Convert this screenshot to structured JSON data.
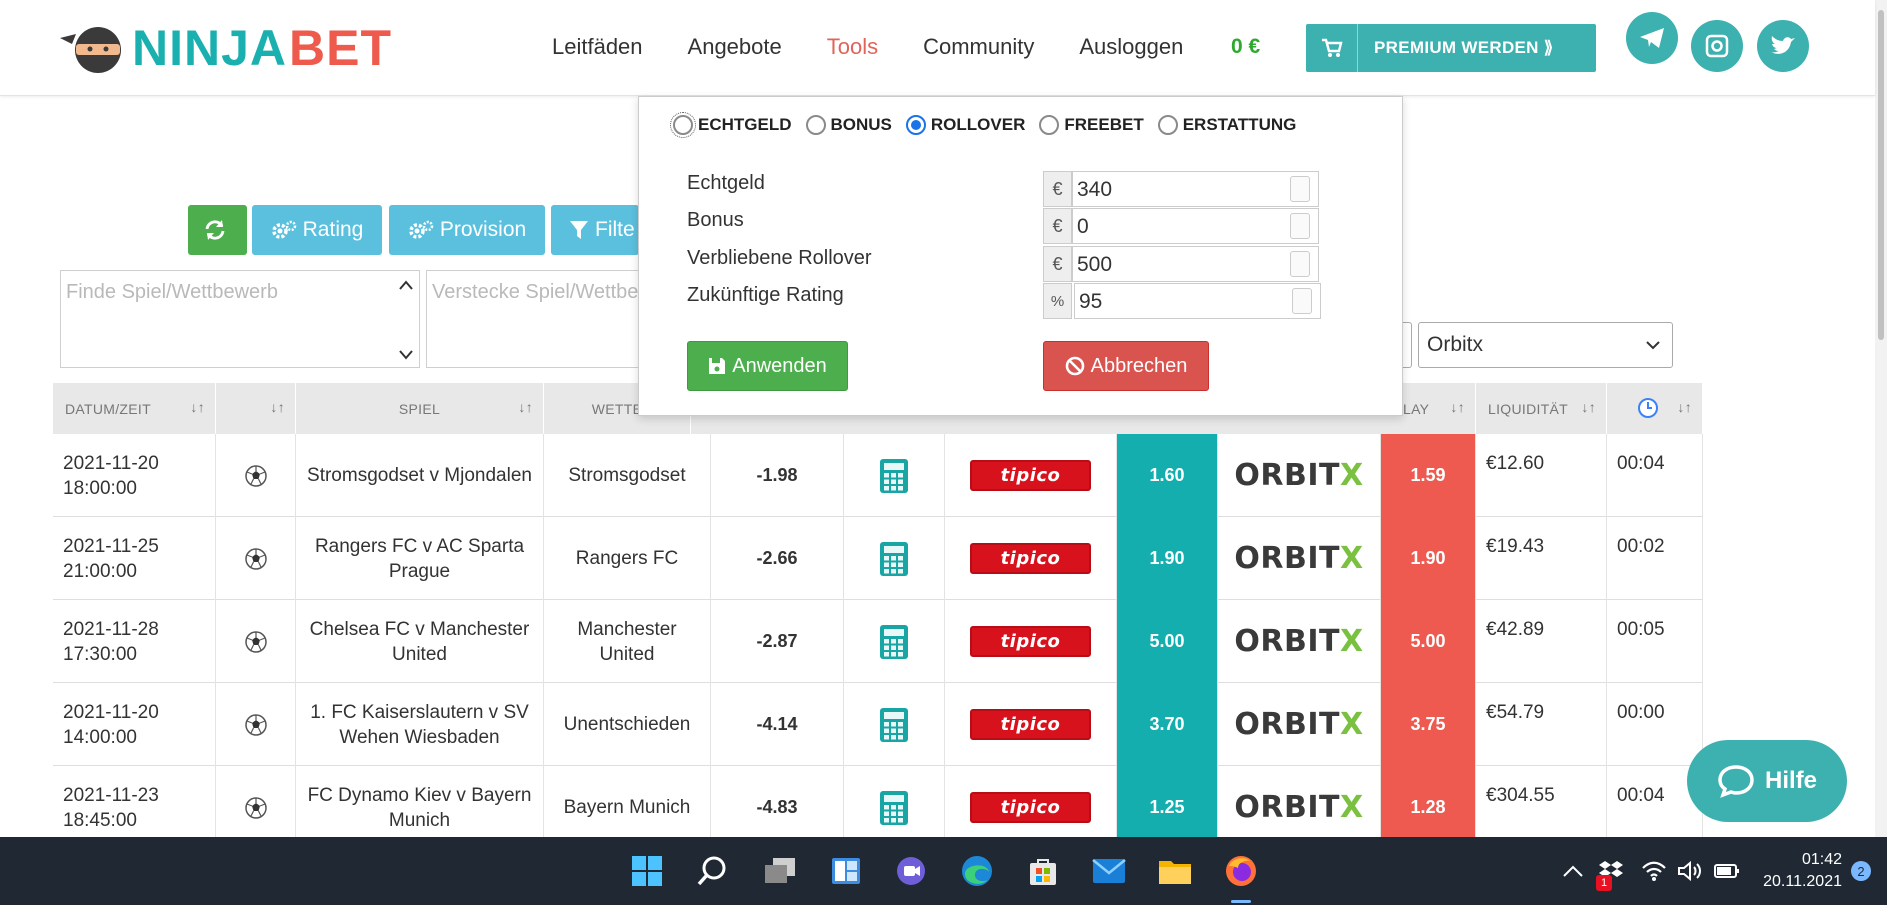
{
  "header": {
    "logo": {
      "part1": "NINJA",
      "part2": "BET"
    },
    "nav": [
      "Leitfäden",
      "Angebote",
      "Tools",
      "Community",
      "Ausloggen"
    ],
    "active_nav": "Tools",
    "balance": "0 €",
    "premium_label": "PREMIUM WERDEN ⟫",
    "social_icons": [
      "telegram-icon",
      "instagram-icon",
      "twitter-icon"
    ]
  },
  "toolbar": {
    "refresh_icon": "refresh-icon",
    "rating_label": "Rating",
    "provision_label": "Provision",
    "filter_label": "Filte",
    "search_placeholder": "Finde Spiel/Wettbewerb",
    "hide_placeholder": "Versteckе Spiel/Wettbe",
    "exchange_select": "Orbitx"
  },
  "popup": {
    "radios": [
      {
        "label": "ECHTGELD",
        "checked": false
      },
      {
        "label": "BONUS",
        "checked": false
      },
      {
        "label": "ROLLOVER",
        "checked": true
      },
      {
        "label": "FREEBET",
        "checked": false
      },
      {
        "label": "ERSTATTUNG",
        "checked": false
      }
    ],
    "fields": [
      {
        "label": "Echtgeld",
        "unit": "€",
        "value": "340"
      },
      {
        "label": "Bonus",
        "unit": "€",
        "value": "0"
      },
      {
        "label": "Verbliebene Rollover",
        "unit": "€",
        "value": "500"
      },
      {
        "label": "Zukünftige Rating",
        "unit": "%",
        "value": "95"
      }
    ],
    "apply_label": "Anwenden",
    "cancel_label": "Abbrechen"
  },
  "table": {
    "headers": {
      "datetime": "DATUM/ZEIT",
      "game": "SPIEL",
      "bet": "WETTE",
      "lay": "LAY",
      "liquidity": "LIQUIDITÄT"
    },
    "rows": [
      {
        "date": "2021-11-20",
        "time": "18:00:00",
        "game": "Stromsgodset v Mjondalen",
        "bet": "Stromsgodset",
        "rating": "-1.98",
        "bookmaker": "tipico",
        "back": "1.60",
        "exchange": "ORBITX",
        "lay": "1.59",
        "liquidity": "€12.60",
        "updated": "00:04"
      },
      {
        "date": "2021-11-25",
        "time": "21:00:00",
        "game": "Rangers FC v AC Sparta Prague",
        "bet": "Rangers FC",
        "rating": "-2.66",
        "bookmaker": "tipico",
        "back": "1.90",
        "exchange": "ORBITX",
        "lay": "1.90",
        "liquidity": "€19.43",
        "updated": "00:02"
      },
      {
        "date": "2021-11-28",
        "time": "17:30:00",
        "game": "Chelsea FC v Manchester United",
        "bet": "Manchester United",
        "rating": "-2.87",
        "bookmaker": "tipico",
        "back": "5.00",
        "exchange": "ORBITX",
        "lay": "5.00",
        "liquidity": "€42.89",
        "updated": "00:05"
      },
      {
        "date": "2021-11-20",
        "time": "14:00:00",
        "game": "1. FC Kaiserslautern v SV Wehen Wiesbaden",
        "bet": "Unentschieden",
        "rating": "-4.14",
        "bookmaker": "tipico",
        "back": "3.70",
        "exchange": "ORBITX",
        "lay": "3.75",
        "liquidity": "€54.79",
        "updated": "00:00"
      },
      {
        "date": "2021-11-23",
        "time": "18:45:00",
        "game": "FC Dynamo Kiev v Bayern Munich",
        "bet": "Bayern Munich",
        "rating": "-4.83",
        "bookmaker": "tipico",
        "back": "1.25",
        "exchange": "ORBITX",
        "lay": "1.28",
        "liquidity": "€304.55",
        "updated": "00:04"
      }
    ]
  },
  "help_label": "Hilfe",
  "taskbar": {
    "apps": [
      "windows-start-icon",
      "search-icon",
      "task-view-icon",
      "widgets-icon",
      "teams-chat-icon",
      "edge-icon",
      "store-icon",
      "mail-icon",
      "file-explorer-icon",
      "firefox-icon"
    ],
    "time": "01:42",
    "date": "20.11.2021",
    "notifications": "2",
    "dropbox_badge": "1"
  },
  "colors": {
    "brand_teal": "#3db0b0",
    "brand_red": "#ee5a4b",
    "green": "#4cae4c",
    "info": "#5bc0de",
    "danger": "#d9534f",
    "back_cell": "#14aeae",
    "lay_cell": "#ee5a4f"
  }
}
